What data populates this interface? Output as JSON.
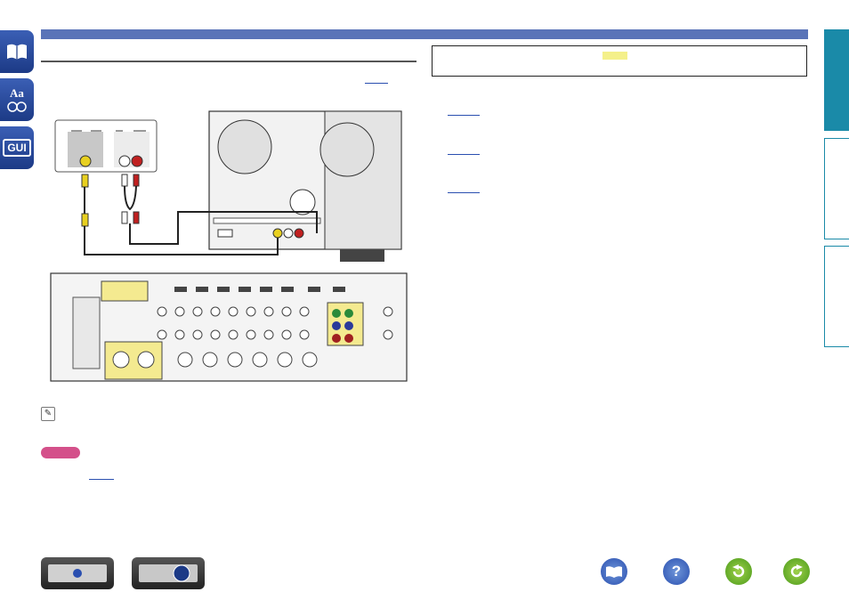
{
  "sidebar": {
    "manual_icon": "book-icon",
    "glossary_icon": "Aa",
    "gui_icon": "GUI"
  },
  "footer": {
    "index_icon": "book-icon",
    "help_icon": "?",
    "back_icon": "undo-arrow-icon",
    "forward_icon": "redo-arrow-icon"
  },
  "colors": {
    "header_bar": "#5a74b8",
    "tab_active": "#1a8aa8",
    "note_pill": "#d4508a",
    "highlight": "#f4f08a"
  }
}
